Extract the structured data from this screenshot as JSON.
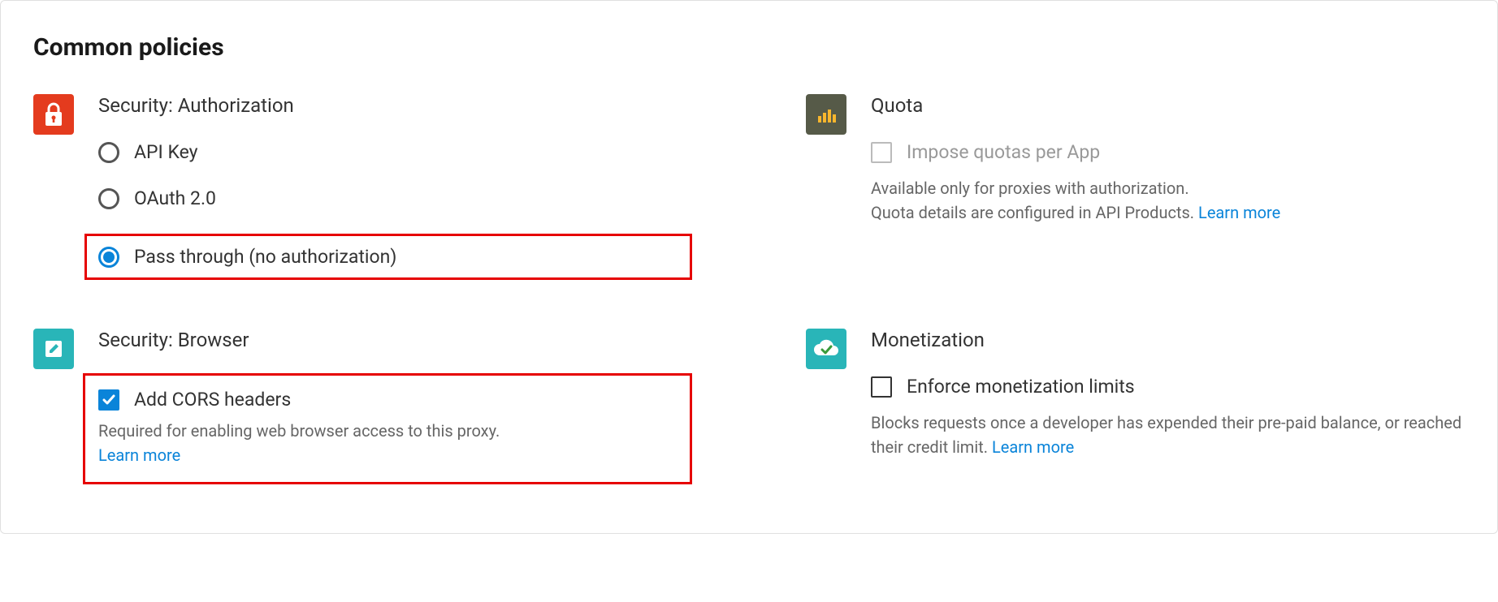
{
  "header": {
    "title": "Common policies"
  },
  "security_auth": {
    "label": "Security: Authorization",
    "options": {
      "api_key": "API Key",
      "oauth": "OAuth 2.0",
      "pass_through": "Pass through (no authorization)"
    },
    "selected": "pass_through"
  },
  "quota": {
    "label": "Quota",
    "option": "Impose quotas per App",
    "checked": false,
    "disabled": true,
    "desc_line1": "Available only for proxies with authorization.",
    "desc_line2": "Quota details are configured in API Products.",
    "learn_more": "Learn more"
  },
  "security_browser": {
    "label": "Security: Browser",
    "option": "Add CORS headers",
    "checked": true,
    "desc": "Required for enabling web browser access to this proxy.",
    "learn_more": "Learn more"
  },
  "monetization": {
    "label": "Monetization",
    "option": "Enforce monetization limits",
    "checked": false,
    "desc": "Blocks requests once a developer has expended their pre-paid balance, or reached their credit limit.",
    "learn_more": "Learn more"
  }
}
